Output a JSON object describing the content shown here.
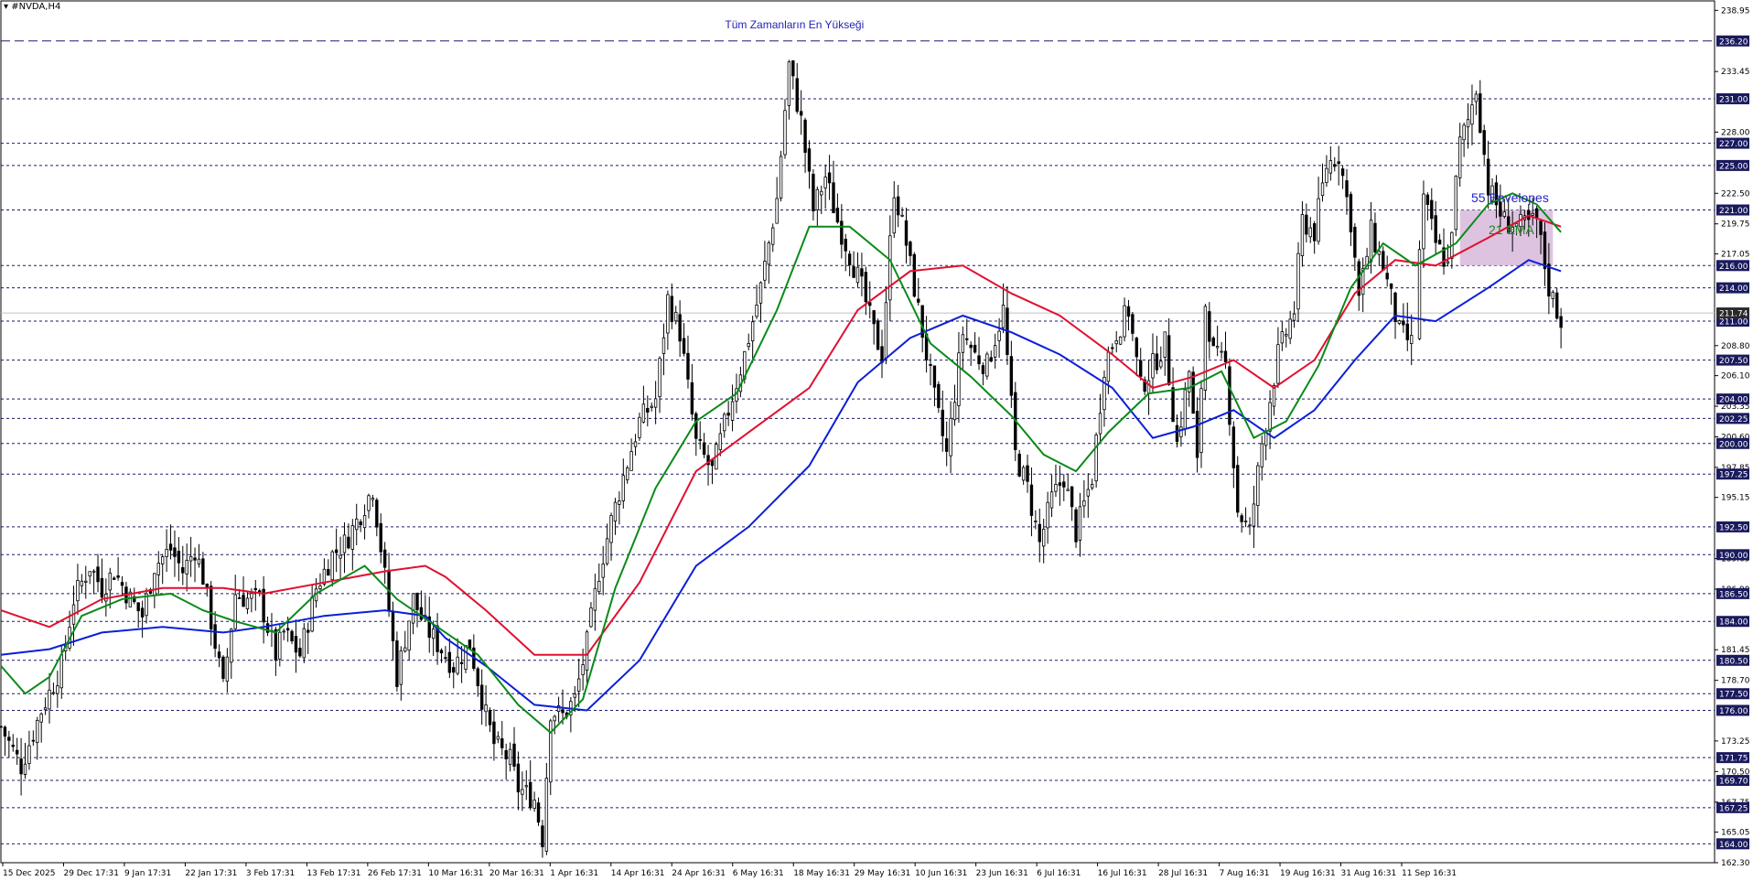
{
  "window": {
    "symbol_label": "#NVDA,H4"
  },
  "annotation": {
    "all_time_high_label": "Tüm Zamanların En Yükseği",
    "all_time_high_level": 236.2
  },
  "legend": {
    "envelopes": "55 Envelopes",
    "ema": "21 EMA"
  },
  "colors": {
    "candles": "#000000",
    "envelope_upper": "#e0102f",
    "envelope_lower": "#0a1fd8",
    "ema": "#0a8a1a",
    "hline": "#1a1a6e",
    "price_tag_bg": "#1a1a5e",
    "zone_fill": "#d8b8dc",
    "current_price_line": "#c0c0c0"
  },
  "chart_data": {
    "type": "candlestick",
    "title": "#NVDA,H4",
    "ylim": [
      162.3,
      239.8
    ],
    "y_tick_labels": [
      "238.95",
      "233.45",
      "228.00",
      "222.50",
      "219.75",
      "217.05",
      "208.80",
      "206.10",
      "203.35",
      "200.60",
      "197.85",
      "195.15",
      "189.65",
      "186.90",
      "181.45",
      "178.70",
      "173.25",
      "170.50",
      "167.75",
      "165.05",
      "162.30"
    ],
    "x_tick_labels": [
      "15 Dec 2025",
      "29 Dec 17:31",
      "9 Jan 17:31",
      "22 Jan 17:31",
      "3 Feb 17:31",
      "13 Feb 17:31",
      "26 Feb 17:31",
      "10 Mar 16:31",
      "20 Mar 16:31",
      "1 Apr 16:31",
      "14 Apr 16:31",
      "24 Apr 16:31",
      "6 May 16:31",
      "18 May 16:31",
      "29 May 16:31",
      "10 Jun 16:31",
      "23 Jun 16:31",
      "6 Jul 16:31",
      "16 Jul 16:31",
      "28 Jul 16:31",
      "7 Aug 16:31",
      "19 Aug 16:31",
      "31 Aug 16:31",
      "11 Sep 16:31"
    ],
    "horizontal_levels": [
      236.2,
      231.0,
      227.0,
      225.0,
      221.0,
      216.0,
      214.0,
      211.0,
      207.5,
      204.0,
      202.25,
      200.0,
      197.25,
      192.5,
      190.0,
      186.5,
      184.0,
      180.5,
      177.5,
      176.0,
      171.75,
      169.7,
      167.25,
      164.0
    ],
    "current_price": 211.74,
    "zone": {
      "from": 216.0,
      "to": 221.0,
      "x_start_label": "31 Aug 16:31"
    },
    "close_path": [
      [
        0,
        174.5
      ],
      [
        5,
        171.0
      ],
      [
        10,
        176.0
      ],
      [
        15,
        180.0
      ],
      [
        18,
        186.0
      ],
      [
        22,
        189.0
      ],
      [
        25,
        187.0
      ],
      [
        28,
        188.5
      ],
      [
        32,
        186.0
      ],
      [
        35,
        184.5
      ],
      [
        38,
        189.0
      ],
      [
        42,
        190.5
      ],
      [
        45,
        188.5
      ],
      [
        48,
        190.5
      ],
      [
        50,
        188.0
      ],
      [
        55,
        178.0
      ],
      [
        58,
        186.5
      ],
      [
        61,
        186.0
      ],
      [
        64,
        186.0
      ],
      [
        68,
        181.0
      ],
      [
        70,
        183.0
      ],
      [
        74,
        181.0
      ],
      [
        78,
        187.0
      ],
      [
        82,
        190.0
      ],
      [
        85,
        191.0
      ],
      [
        88,
        193.0
      ],
      [
        92,
        196.0
      ],
      [
        95,
        188.0
      ],
      [
        98,
        179.0
      ],
      [
        102,
        186.0
      ],
      [
        105,
        183.5
      ],
      [
        108,
        182.0
      ],
      [
        112,
        180.0
      ],
      [
        116,
        182.0
      ],
      [
        120,
        175.5
      ],
      [
        122,
        173.0
      ],
      [
        126,
        171.5
      ],
      [
        128,
        169.0
      ],
      [
        132,
        168.0
      ],
      [
        134,
        164.5
      ],
      [
        136,
        176.0
      ],
      [
        139,
        175.5
      ],
      [
        142,
        177.0
      ],
      [
        145,
        182.0
      ],
      [
        148,
        188.5
      ],
      [
        151,
        193.0
      ],
      [
        154,
        197.0
      ],
      [
        158,
        202.0
      ],
      [
        162,
        204.0
      ],
      [
        165,
        213.0
      ],
      [
        168,
        210.0
      ],
      [
        172,
        200.0
      ],
      [
        176,
        197.5
      ],
      [
        180,
        203.0
      ],
      [
        184,
        208.0
      ],
      [
        188,
        214.0
      ],
      [
        192,
        222.0
      ],
      [
        195,
        234.0
      ],
      [
        198,
        229.0
      ],
      [
        201,
        221.0
      ],
      [
        204,
        224.0
      ],
      [
        207,
        220.0
      ],
      [
        210,
        217.0
      ],
      [
        213,
        214.0
      ],
      [
        216,
        210.0
      ],
      [
        218,
        208.0
      ],
      [
        221,
        223.0
      ],
      [
        224,
        218.0
      ],
      [
        228,
        210.0
      ],
      [
        231,
        204.0
      ],
      [
        234,
        199.0
      ],
      [
        238,
        210.0
      ],
      [
        241,
        208.0
      ],
      [
        244,
        207.0
      ],
      [
        248,
        212.0
      ],
      [
        251,
        199.0
      ],
      [
        254,
        196.0
      ],
      [
        257,
        191.0
      ],
      [
        260,
        195.0
      ],
      [
        263,
        197.0
      ],
      [
        266,
        192.0
      ],
      [
        270,
        197.0
      ],
      [
        273,
        207.0
      ],
      [
        276,
        210.0
      ],
      [
        279,
        212.0
      ],
      [
        282,
        205.0
      ],
      [
        285,
        207.0
      ],
      [
        288,
        209.0
      ],
      [
        291,
        200.0
      ],
      [
        294,
        206.5
      ],
      [
        296,
        198.0
      ],
      [
        298,
        212.5
      ],
      [
        300,
        208.0
      ],
      [
        303,
        207.0
      ],
      [
        306,
        194.0
      ],
      [
        309,
        192.0
      ],
      [
        312,
        200.0
      ],
      [
        316,
        208.0
      ],
      [
        320,
        212.0
      ],
      [
        322,
        220.0
      ],
      [
        325,
        219.0
      ],
      [
        328,
        225.0
      ],
      [
        331,
        226.0
      ],
      [
        334,
        220.0
      ],
      [
        336,
        213.0
      ],
      [
        339,
        219.0
      ],
      [
        342,
        216.0
      ],
      [
        346,
        210.0
      ],
      [
        349,
        209.0
      ],
      [
        352,
        222.0
      ],
      [
        355,
        218.0
      ],
      [
        358,
        216.0
      ],
      [
        361,
        227.0
      ],
      [
        363,
        229.0
      ],
      [
        365,
        232.0
      ],
      [
        368,
        223.0
      ],
      [
        372,
        220.0
      ],
      [
        376,
        219.5
      ],
      [
        380,
        220.0
      ],
      [
        383,
        214.0
      ],
      [
        386,
        211.0
      ]
    ],
    "envelope_upper_path": [
      [
        0,
        185.0
      ],
      [
        12,
        183.5
      ],
      [
        25,
        186.0
      ],
      [
        40,
        187.0
      ],
      [
        55,
        187.0
      ],
      [
        65,
        186.5
      ],
      [
        80,
        187.5
      ],
      [
        95,
        188.5
      ],
      [
        105,
        189.0
      ],
      [
        110,
        188.0
      ],
      [
        120,
        185.0
      ],
      [
        132,
        181.0
      ],
      [
        145,
        181.0
      ],
      [
        158,
        187.5
      ],
      [
        172,
        197.5
      ],
      [
        185,
        201.0
      ],
      [
        200,
        205.0
      ],
      [
        212,
        212.0
      ],
      [
        225,
        215.5
      ],
      [
        238,
        216.0
      ],
      [
        250,
        213.5
      ],
      [
        262,
        211.5
      ],
      [
        275,
        208.0
      ],
      [
        285,
        205.0
      ],
      [
        295,
        206.0
      ],
      [
        305,
        207.5
      ],
      [
        315,
        205.0
      ],
      [
        325,
        207.5
      ],
      [
        335,
        213.5
      ],
      [
        345,
        216.5
      ],
      [
        355,
        216.0
      ],
      [
        368,
        218.5
      ],
      [
        378,
        220.5
      ],
      [
        386,
        219.5
      ]
    ],
    "envelope_lower_path": [
      [
        0,
        181.0
      ],
      [
        12,
        181.5
      ],
      [
        25,
        183.0
      ],
      [
        40,
        183.5
      ],
      [
        55,
        183.0
      ],
      [
        65,
        183.5
      ],
      [
        80,
        184.5
      ],
      [
        95,
        185.0
      ],
      [
        105,
        184.5
      ],
      [
        110,
        182.5
      ],
      [
        120,
        180.0
      ],
      [
        132,
        176.5
      ],
      [
        145,
        176.0
      ],
      [
        158,
        180.5
      ],
      [
        172,
        189.0
      ],
      [
        185,
        192.5
      ],
      [
        200,
        198.0
      ],
      [
        212,
        205.5
      ],
      [
        225,
        209.5
      ],
      [
        238,
        211.5
      ],
      [
        250,
        210.0
      ],
      [
        262,
        208.0
      ],
      [
        275,
        205.0
      ],
      [
        285,
        200.5
      ],
      [
        295,
        201.5
      ],
      [
        305,
        203.0
      ],
      [
        315,
        200.5
      ],
      [
        325,
        203.0
      ],
      [
        335,
        207.5
      ],
      [
        345,
        211.5
      ],
      [
        355,
        211.0
      ],
      [
        368,
        214.0
      ],
      [
        378,
        216.5
      ],
      [
        386,
        215.5
      ]
    ],
    "ema_path": [
      [
        0,
        180.0
      ],
      [
        6,
        177.5
      ],
      [
        12,
        179.0
      ],
      [
        20,
        184.5
      ],
      [
        30,
        186.0
      ],
      [
        42,
        186.5
      ],
      [
        50,
        185.0
      ],
      [
        58,
        184.0
      ],
      [
        68,
        183.0
      ],
      [
        78,
        186.5
      ],
      [
        90,
        189.0
      ],
      [
        98,
        186.0
      ],
      [
        108,
        183.5
      ],
      [
        118,
        181.0
      ],
      [
        128,
        176.5
      ],
      [
        136,
        174.0
      ],
      [
        144,
        177.0
      ],
      [
        152,
        187.0
      ],
      [
        162,
        196.0
      ],
      [
        172,
        202.0
      ],
      [
        182,
        204.5
      ],
      [
        192,
        212.0
      ],
      [
        200,
        219.5
      ],
      [
        210,
        219.5
      ],
      [
        220,
        216.5
      ],
      [
        230,
        209.0
      ],
      [
        240,
        206.0
      ],
      [
        250,
        202.5
      ],
      [
        258,
        199.0
      ],
      [
        266,
        197.5
      ],
      [
        274,
        201.0
      ],
      [
        284,
        204.5
      ],
      [
        294,
        205.0
      ],
      [
        302,
        206.5
      ],
      [
        310,
        200.5
      ],
      [
        318,
        202.0
      ],
      [
        326,
        207.0
      ],
      [
        334,
        214.0
      ],
      [
        342,
        218.0
      ],
      [
        350,
        216.0
      ],
      [
        360,
        218.0
      ],
      [
        368,
        221.5
      ],
      [
        374,
        222.5
      ],
      [
        380,
        221.5
      ],
      [
        386,
        219.0
      ]
    ]
  }
}
